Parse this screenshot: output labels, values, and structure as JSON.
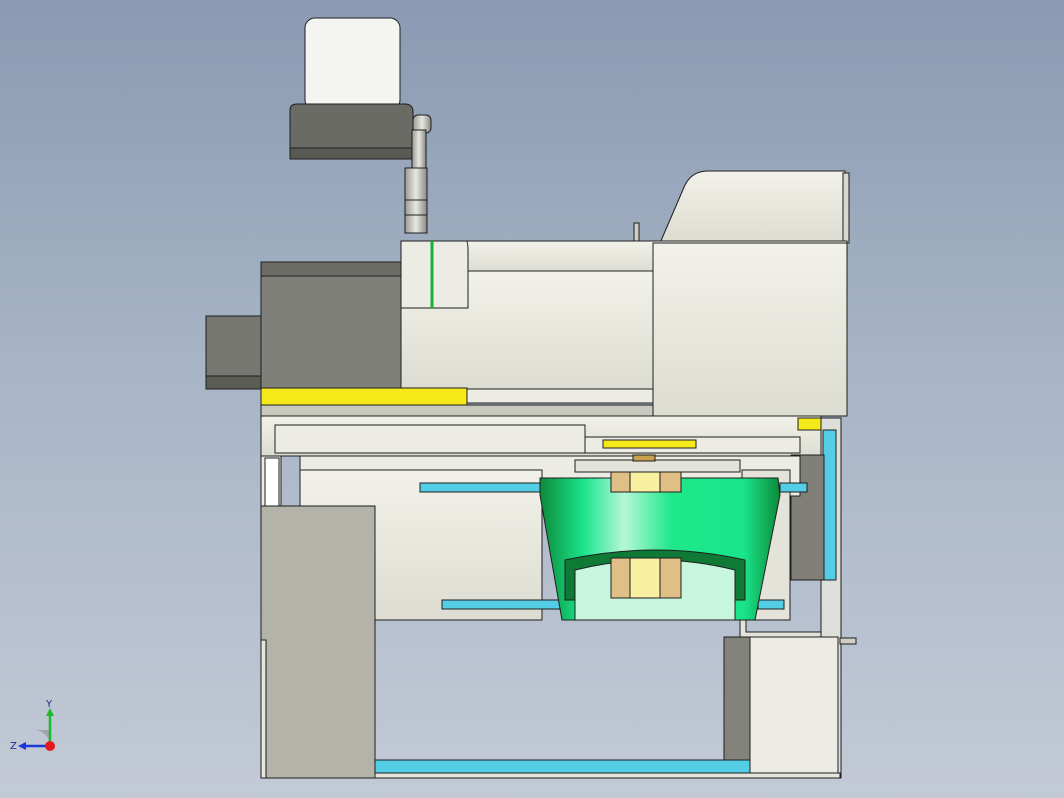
{
  "viewport": {
    "background_top": "#8a9ab2",
    "background_bottom": "#c3cad6"
  },
  "colors": {
    "part_body": "#e6e6dc",
    "part_dark": "#7e7e76",
    "part_darker": "#5f5f59",
    "part_mid": "#b2b2a8",
    "highlight_yellow": "#f6e91a",
    "highlight_cyan": "#54cde6",
    "green_bright": "#15e885",
    "green_dark": "#11913d",
    "tan": "#dfbf85",
    "edge": "#1e1e1e"
  },
  "triad": {
    "x_label": "Z",
    "y_label": "Y",
    "x_axis_color": "#1d38d6",
    "y_axis_color": "#1dbb2a",
    "origin_color": "#e31b1b"
  }
}
